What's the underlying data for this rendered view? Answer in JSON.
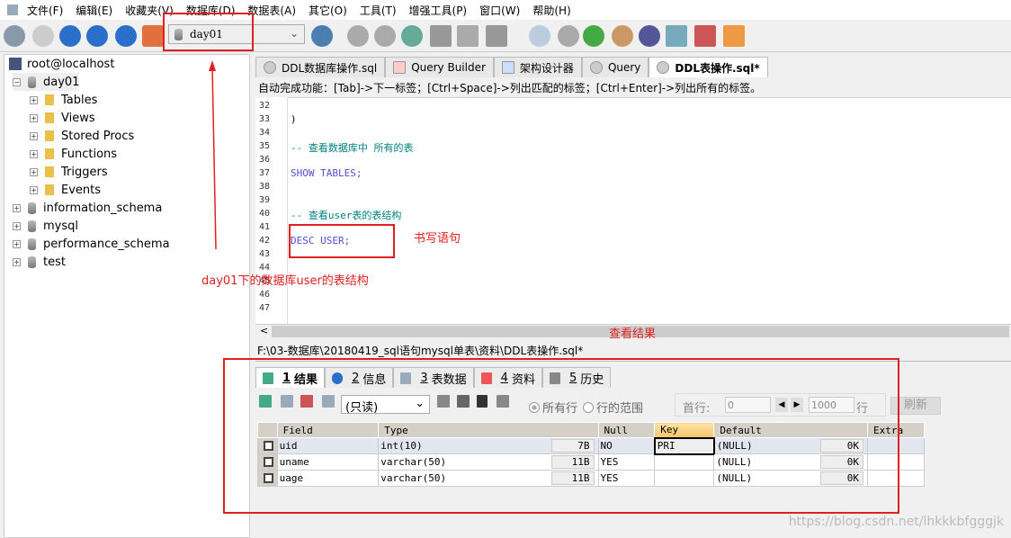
{
  "menu": [
    "文件(F)",
    "编辑(E)",
    "收藏夹(V)",
    "数据库(D)",
    "数据表(A)",
    "其它(O)",
    "工具(T)",
    "增强工具(P)",
    "窗口(W)",
    "帮助(H)"
  ],
  "toolbar": {
    "db_selector": "day01"
  },
  "tree": {
    "connection": "root@localhost",
    "databases": [
      "day01",
      "information_schema",
      "mysql",
      "performance_schema",
      "test"
    ],
    "day01_children": [
      "Tables",
      "Views",
      "Stored Procs",
      "Functions",
      "Triggers",
      "Events"
    ]
  },
  "tabs": [
    "DDL数据库操作.sql",
    "Query Builder",
    "架构设计器",
    "Query",
    "DDL表操作.sql*"
  ],
  "hint": "自动完成功能：[Tab]->下一标签；[Ctrl+Space]->列出匹配的标签；[Ctrl+Enter]->列出所有的标签。",
  "editor": {
    "line_numbers": [
      "32",
      "33",
      "34",
      "35",
      "36",
      "37",
      "38",
      "39",
      "40",
      "41",
      "42",
      "43",
      "44",
      "45",
      "46",
      "47"
    ],
    "lines": {
      "33": ")",
      "35": "-- 查看数据库中 所有的表",
      "37": "SHOW TABLES;",
      "40": "-- 查看user表的表结构",
      "42": "DESC USER;"
    }
  },
  "file_path": "F:\\03-数据库\\20180419_sql语句mysql单表\\资料\\DDL表操作.sql*",
  "result_tabs": [
    {
      "num": "1",
      "label": "结果"
    },
    {
      "num": "2",
      "label": "信息"
    },
    {
      "num": "3",
      "label": "表数据"
    },
    {
      "num": "4",
      "label": "资料"
    },
    {
      "num": "5",
      "label": "历史"
    }
  ],
  "result_toolbar": {
    "mode": "(只读)",
    "all_rows": "所有行",
    "row_range": "行的范围",
    "first_row_label": "首行:",
    "first_row": "0",
    "count": "1000",
    "row_unit": "行",
    "refresh": "刷新"
  },
  "grid": {
    "columns": [
      "Field",
      "Type",
      "Null",
      "Key",
      "Default",
      "Extra"
    ],
    "rows": [
      {
        "field": "uid",
        "type": "int(10)",
        "type_size": "7B",
        "null": "NO",
        "key": "PRI",
        "default": "(NULL)",
        "default_size": "0K",
        "extra": ""
      },
      {
        "field": "uname",
        "type": "varchar(50)",
        "type_size": "11B",
        "null": "YES",
        "key": "",
        "default": "(NULL)",
        "default_size": "0K",
        "extra": ""
      },
      {
        "field": "uage",
        "type": "varchar(50)",
        "type_size": "11B",
        "null": "YES",
        "key": "",
        "default": "(NULL)",
        "default_size": "0K",
        "extra": ""
      }
    ]
  },
  "annotations": {
    "db_note": "day01下的数据库user的表结构",
    "write_note": "书写语句",
    "result_note": "查看结果",
    "color": "#e02020"
  },
  "watermark": "https://blog.csdn.net/lhkkkbfgggjk"
}
